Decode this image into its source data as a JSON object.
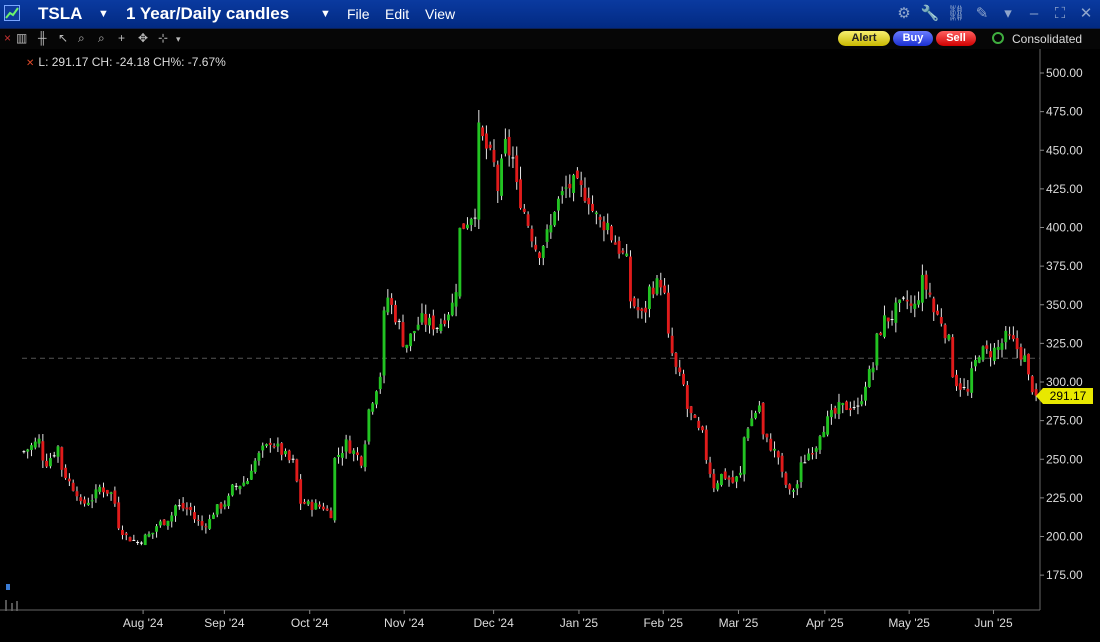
{
  "window": {
    "symbol": "TSLA",
    "period": "1 Year/Daily candles",
    "menu": [
      "File",
      "Edit",
      "View"
    ]
  },
  "toolbar": {
    "alert_label": "Alert",
    "buy_label": "Buy",
    "sell_label": "Sell",
    "consolidated_label": "Consolidated"
  },
  "legend_text": "L: 291.17 CH: -24.18 CH%: -7.67%",
  "last_price_label": "291.17",
  "colors": {
    "up": "#22c322",
    "down": "#e01b1b",
    "doji": "#ffffff",
    "last": "#e8e800"
  },
  "chart_data": {
    "type": "candlestick",
    "x_tick_labels": [
      "Aug '24",
      "Sep '24",
      "Oct '24",
      "Nov '24",
      "Dec '24",
      "Jan '25",
      "Feb '25",
      "Mar '25",
      "Apr '25",
      "May '25",
      "Jun '25"
    ],
    "y_ticks": [
      175,
      200,
      225,
      250,
      275,
      300,
      325,
      350,
      375,
      400,
      425,
      450,
      475,
      500
    ],
    "y_tick_labels": [
      "175.00",
      "200.00",
      "225.00",
      "250.00",
      "275.00",
      "300.00",
      "325.00",
      "350.00",
      "375.00",
      "400.00",
      "425.00",
      "450.00",
      "475.00",
      "500.00"
    ],
    "ylim": [
      155,
      508
    ],
    "last": 291.17,
    "reference_line": 315.35,
    "close_path": [
      [
        0,
        255
      ],
      [
        4,
        262
      ],
      [
        8,
        248
      ],
      [
        11,
        258
      ],
      [
        16,
        235
      ],
      [
        21,
        220
      ],
      [
        24,
        225
      ],
      [
        27,
        233
      ],
      [
        31,
        228
      ],
      [
        33,
        215
      ],
      [
        37,
        200
      ],
      [
        41,
        195
      ],
      [
        45,
        201
      ],
      [
        51,
        210
      ],
      [
        56,
        220
      ],
      [
        61,
        216
      ],
      [
        65,
        207
      ],
      [
        68,
        212
      ],
      [
        73,
        222
      ],
      [
        77,
        231
      ],
      [
        82,
        238
      ],
      [
        87,
        256
      ],
      [
        91,
        262
      ],
      [
        95,
        252
      ],
      [
        99,
        248
      ],
      [
        101,
        222
      ],
      [
        106,
        220
      ],
      [
        110,
        219
      ],
      [
        113,
        215
      ],
      [
        114,
        250
      ],
      [
        118,
        263
      ],
      [
        122,
        252
      ],
      [
        125,
        244
      ],
      [
        127,
        282
      ],
      [
        130,
        305
      ],
      [
        134,
        355
      ],
      [
        138,
        330
      ],
      [
        141,
        325
      ],
      [
        145,
        342
      ],
      [
        149,
        338
      ],
      [
        153,
        335
      ],
      [
        157,
        350
      ],
      [
        161,
        398
      ],
      [
        165,
        412
      ],
      [
        168,
        462
      ],
      [
        172,
        440
      ],
      [
        175,
        425
      ],
      [
        177,
        453
      ],
      [
        180,
        440
      ],
      [
        183,
        418
      ],
      [
        186,
        395
      ],
      [
        190,
        385
      ],
      [
        193,
        400
      ],
      [
        196,
        413
      ],
      [
        199,
        425
      ],
      [
        202,
        430
      ],
      [
        206,
        422
      ],
      [
        209,
        415
      ],
      [
        212,
        403
      ],
      [
        215,
        402
      ],
      [
        218,
        390
      ],
      [
        221,
        378
      ],
      [
        224,
        353
      ],
      [
        227,
        343
      ],
      [
        231,
        360
      ],
      [
        234,
        365
      ],
      [
        236,
        345
      ],
      [
        238,
        328
      ],
      [
        240,
        308
      ],
      [
        243,
        292
      ],
      [
        246,
        278
      ],
      [
        248,
        268
      ],
      [
        251,
        260
      ],
      [
        254,
        233
      ],
      [
        257,
        243
      ],
      [
        261,
        235
      ],
      [
        263,
        240
      ],
      [
        267,
        272
      ],
      [
        270,
        285
      ],
      [
        273,
        265
      ],
      [
        276,
        255
      ],
      [
        279,
        245
      ],
      [
        282,
        228
      ],
      [
        285,
        237
      ],
      [
        289,
        254
      ],
      [
        293,
        265
      ],
      [
        297,
        278
      ],
      [
        301,
        283
      ],
      [
        305,
        285
      ],
      [
        308,
        282
      ],
      [
        310,
        300
      ],
      [
        313,
        315
      ],
      [
        317,
        340
      ],
      [
        321,
        345
      ],
      [
        325,
        352
      ],
      [
        328,
        340
      ],
      [
        331,
        365
      ],
      [
        335,
        348
      ],
      [
        338,
        340
      ],
      [
        340,
        326
      ],
      [
        344,
        300
      ],
      [
        348,
        290
      ],
      [
        352,
        320
      ],
      [
        356,
        318
      ],
      [
        359,
        322
      ],
      [
        362,
        332
      ],
      [
        365,
        325
      ],
      [
        368,
        315
      ],
      [
        370,
        308
      ],
      [
        373,
        291
      ]
    ]
  }
}
